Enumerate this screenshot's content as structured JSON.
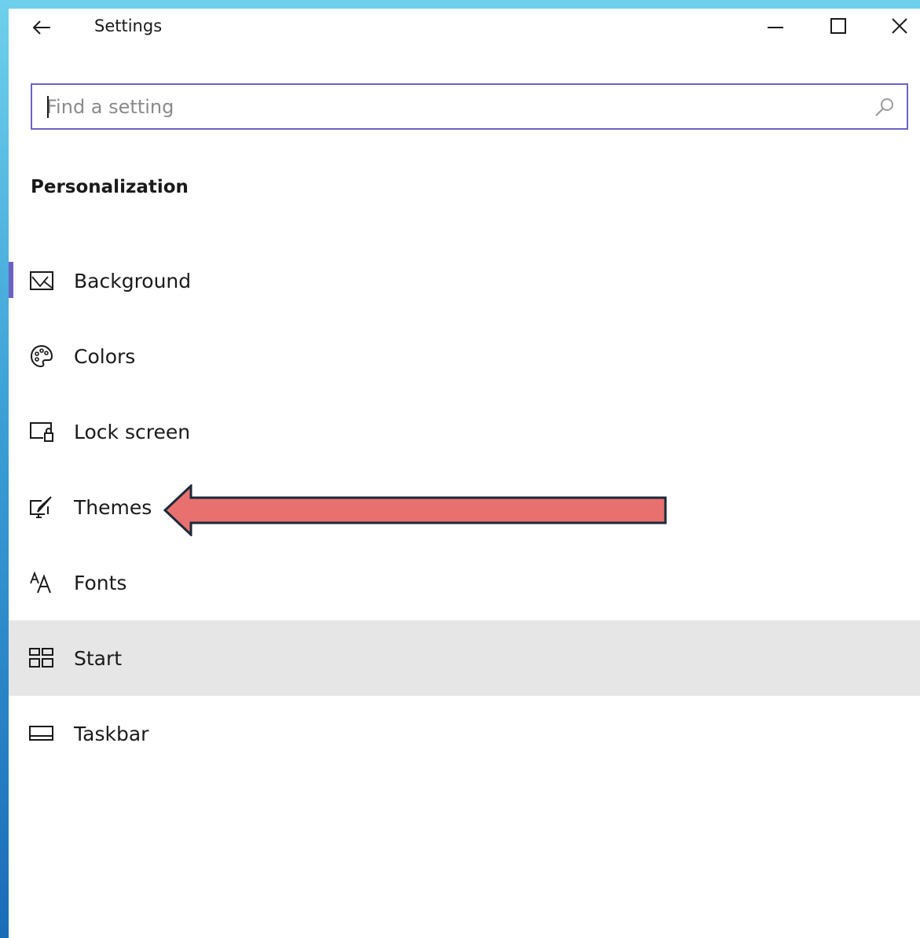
{
  "window": {
    "title": "Settings"
  },
  "search": {
    "placeholder": "Find a setting",
    "value": ""
  },
  "section": {
    "heading": "Personalization"
  },
  "nav": {
    "items": [
      {
        "label": "Background",
        "icon": "picture-icon",
        "selected": true
      },
      {
        "label": "Colors",
        "icon": "palette-icon"
      },
      {
        "label": "Lock screen",
        "icon": "lock-screen-icon"
      },
      {
        "label": "Themes",
        "icon": "themes-brush-icon"
      },
      {
        "label": "Fonts",
        "icon": "fonts-icon"
      },
      {
        "label": "Start",
        "icon": "start-tiles-icon",
        "hovered": true
      },
      {
        "label": "Taskbar",
        "icon": "taskbar-icon"
      }
    ]
  },
  "annotation": {
    "arrow_color": "#e8706f",
    "arrow_outline": "#1b2a3a",
    "points_to": "Themes"
  },
  "colors": {
    "accent": "#6b63c4",
    "hover_bg": "#e6e6e6"
  }
}
